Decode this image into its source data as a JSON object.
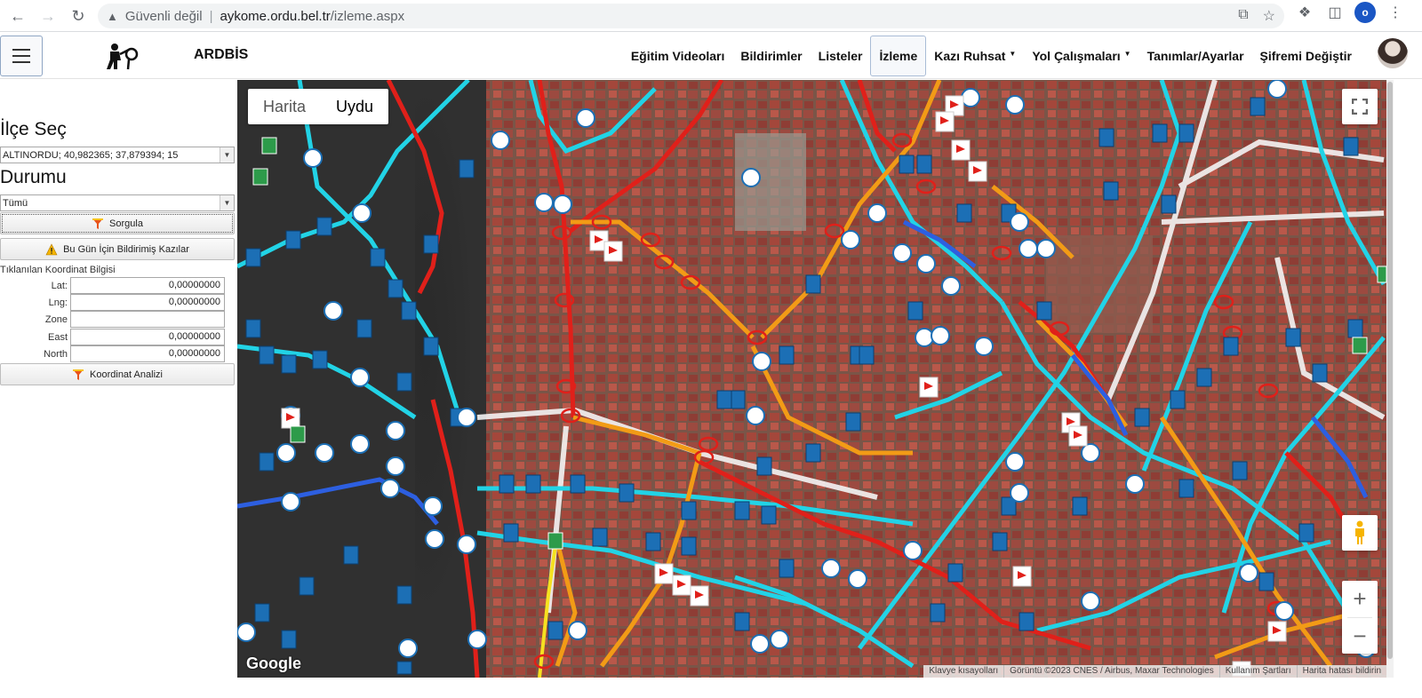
{
  "browser": {
    "security_text": "Güvenli değil",
    "url_host": "aykome.ordu.bel.tr",
    "url_path": "/izleme.aspx",
    "profile_initial": "o"
  },
  "header": {
    "brand": "ARDBİS",
    "nav": [
      {
        "label": "Eğitim Videoları"
      },
      {
        "label": "Bildirimler"
      },
      {
        "label": "Listeler"
      },
      {
        "label": "İzleme"
      },
      {
        "label": "Kazı Ruhsat"
      },
      {
        "label": "Yol Çalışmaları"
      },
      {
        "label": "Tanımlar/Ayarlar"
      },
      {
        "label": "Şifremi Değiştir"
      }
    ]
  },
  "sidebar": {
    "ilce_heading": "İlçe Seç",
    "ilce_value": "ALTINORDU; 40,982365; 37,879394; 15",
    "durum_heading": "Durumu",
    "durum_value": "Tümü",
    "sorgula_label": "Sorgula",
    "bugun_label": "Bu Gün İçin Bildirimiş Kazılar",
    "coord_title": "Tıklanılan Koordinat Bilgisi",
    "coords": [
      {
        "label": "Lat:",
        "value": "0,00000000"
      },
      {
        "label": "Lng:",
        "value": "0,00000000"
      },
      {
        "label": "Zone",
        "value": ""
      },
      {
        "label": "East",
        "value": "0,00000000"
      },
      {
        "label": "North",
        "value": "0,00000000"
      }
    ],
    "analiz_label": "Koordinat Analizi"
  },
  "map": {
    "type_harita": "Harita",
    "type_uydu": "Uydu",
    "google": "Google",
    "attribution": [
      "Klavye kısayolları",
      "Görüntü ©2023 CNES / Airbus, Maxar Technologies",
      "Kullanım Şartları",
      "Harita hatası bildirin"
    ],
    "colors": {
      "water_line": "#22d3e6",
      "excavation_red": "#e0201a",
      "road_orange": "#f29b16",
      "sewer_blue": "#2d5fe0",
      "marker": "#1c6fb5"
    }
  }
}
